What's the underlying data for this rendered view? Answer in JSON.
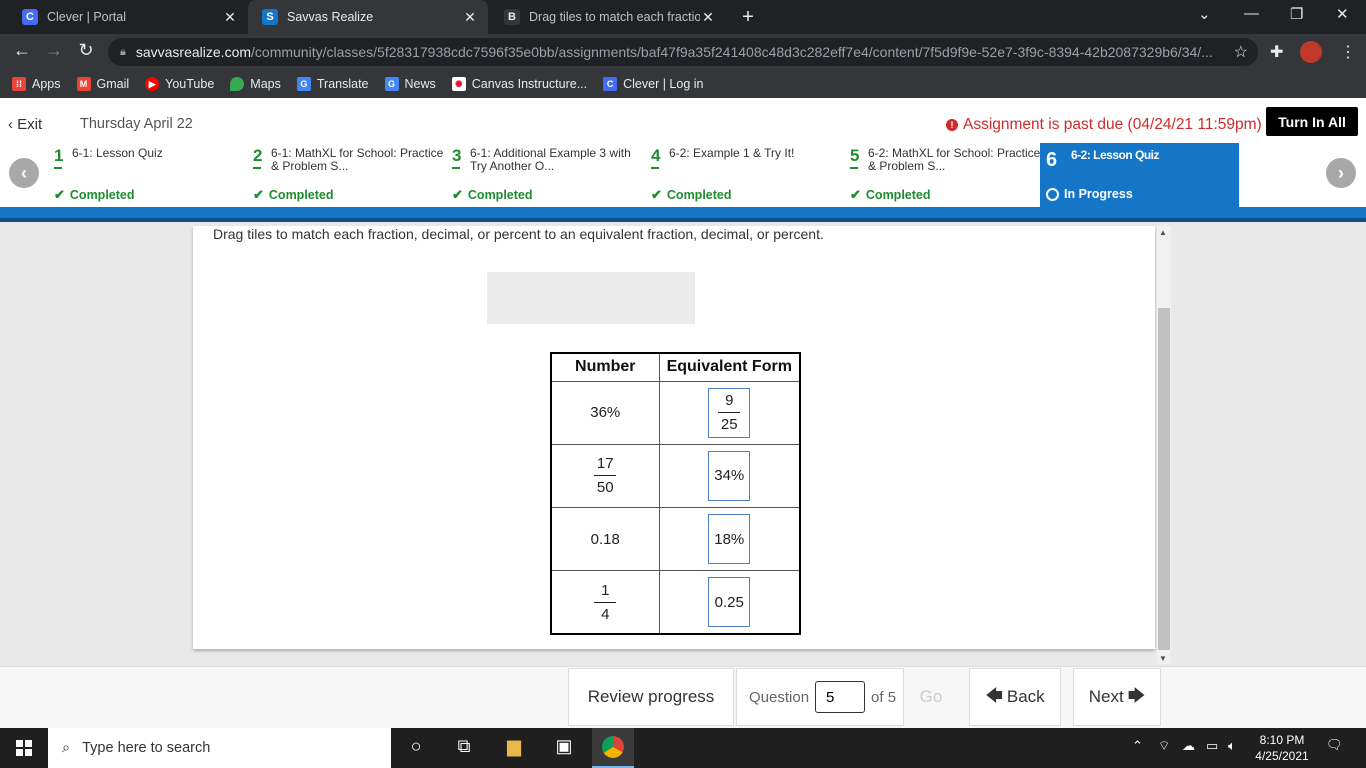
{
  "browser": {
    "tabs": [
      {
        "title": "Clever | Portal",
        "icon": "clever-icon",
        "icon_glyph": "C",
        "icon_color": "#436cf2"
      },
      {
        "title": "Savvas Realize",
        "icon": "savvas-icon",
        "icon_glyph": "S",
        "icon_color": "#1575c6"
      },
      {
        "title": "Drag tiles to match each fraction",
        "icon": "pearson-icon",
        "icon_glyph": "B",
        "icon_color": "#35363a"
      }
    ],
    "url_host": "savvasrealize.com",
    "url_path": "/community/classes/5f28317938cdc7596f35e0bb/assignments/baf47f9a35f241408c48d3c282eff7e4/content/7f5d9f9e-52e7-3f9c-8394-42b2087329b6/34/..."
  },
  "bookmarks": [
    {
      "label": "Apps",
      "icon": "apps-grid-icon",
      "color": "#e8453c"
    },
    {
      "label": "Gmail",
      "icon": "gmail-icon",
      "color": "#ea4335"
    },
    {
      "label": "YouTube",
      "icon": "youtube-icon",
      "color": "#ff0000"
    },
    {
      "label": "Maps",
      "icon": "maps-pin-icon",
      "color": "#34a853"
    },
    {
      "label": "Translate",
      "icon": "translate-icon",
      "color": "#4285f4"
    },
    {
      "label": "News",
      "icon": "news-icon",
      "color": "#4285f4"
    },
    {
      "label": "Canvas Instructure...",
      "icon": "canvas-icon",
      "color": "#ffffff"
    },
    {
      "label": "Clever | Log in",
      "icon": "clever-icon",
      "color": "#436cf2"
    }
  ],
  "header": {
    "exit": "Exit",
    "date": "Thursday April 22",
    "past_due": "Assignment is past due (04/24/21 11:59pm)",
    "turn_in": "Turn In All"
  },
  "steps": [
    {
      "num": "1",
      "name": "6-1: Lesson Quiz",
      "status": "Completed"
    },
    {
      "num": "2",
      "name": "6-1: MathXL for School: Practice & Problem S...",
      "status": "Completed"
    },
    {
      "num": "3",
      "name": "6-1: Additional Example 3 with Try Another O...",
      "status": "Completed"
    },
    {
      "num": "4",
      "name": "6-2: Example 1 & Try It!",
      "status": "Completed"
    },
    {
      "num": "5",
      "name": "6-2: MathXL for School: Practice & Problem S...",
      "status": "Completed"
    },
    {
      "num": "6",
      "name": "6-2: Lesson Quiz",
      "status": "In Progress"
    }
  ],
  "question": {
    "instruction": "Drag tiles to match each fraction, decimal, or percent to an equivalent fraction, decimal, or percent.",
    "col_number": "Number",
    "col_equiv": "Equivalent Form",
    "rows": [
      {
        "number": "36%",
        "answer_num": "9",
        "answer_den": "25"
      },
      {
        "number_num": "17",
        "number_den": "50",
        "answer": "34%"
      },
      {
        "number": "0.18",
        "answer": "18%"
      },
      {
        "number_num": "1",
        "number_den": "4",
        "answer": "0.25"
      }
    ]
  },
  "footer": {
    "review": "Review progress",
    "question_label": "Question",
    "question_value": "5",
    "of_total": "of 5",
    "go": "Go",
    "back": "Back",
    "next": "Next"
  },
  "taskbar": {
    "search_placeholder": "Type here to search",
    "time": "8:10 PM",
    "date": "4/25/2021"
  },
  "colors": {
    "accent": "#1575c6",
    "completed": "#1e8c2f",
    "past_due": "#cc2b2b"
  }
}
